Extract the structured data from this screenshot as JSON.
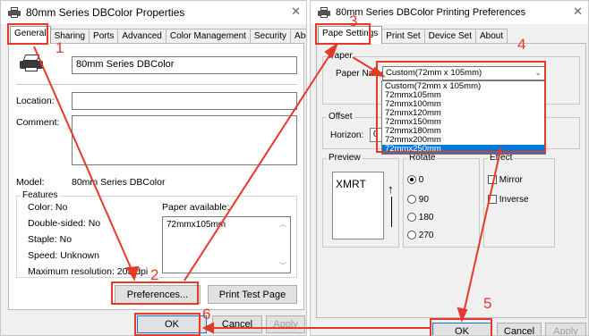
{
  "properties_window": {
    "title": "80mm Series DBColor Properties",
    "close_glyph": "✕",
    "tabs": [
      {
        "label": "General"
      },
      {
        "label": "Sharing"
      },
      {
        "label": "Ports"
      },
      {
        "label": "Advanced"
      },
      {
        "label": "Color Management"
      },
      {
        "label": "Security"
      },
      {
        "label": "About"
      }
    ],
    "printer_name_value": "80mm Series DBColor",
    "location_label": "Location:",
    "location_value": "",
    "comment_label": "Comment:",
    "comment_value": "",
    "model_label": "Model:",
    "model_value": "80mm Series DBColor",
    "features_title": "Features",
    "color_line": "Color: No",
    "double_sided_line": "Double-sided: No",
    "staple_line": "Staple: No",
    "speed_line": "Speed: Unknown",
    "max_res_line": "Maximum resolution: 203 dpi",
    "paper_available_label": "Paper available:",
    "paper_available_items": [
      "72mmx105mm"
    ],
    "preferences_button": "Preferences...",
    "print_test_page_button": "Print Test Page",
    "ok_button": "OK",
    "cancel_button": "Cancel",
    "apply_button": "Apply"
  },
  "preferences_window": {
    "title": "80mm Series DBColor Printing Preferences",
    "close_glyph": "✕",
    "tabs": [
      {
        "label": "Pape Settings"
      },
      {
        "label": "Print Set"
      },
      {
        "label": "Device Set"
      },
      {
        "label": "About"
      }
    ],
    "paper_group_title": "Paper",
    "paper_name_label": "Paper Name:",
    "paper_name_selected": "Custom(72mm x 105mm)",
    "paper_options": [
      "Custom(72mm x 105mm)",
      "72mmx105mm",
      "72mmx100mm",
      "72mmx120mm",
      "72mmx150mm",
      "72mmx180mm",
      "72mmx200mm",
      "72mmx250mm"
    ],
    "paper_selected_index": 7,
    "offset_group_title": "Offset",
    "horizon_label": "Horizon:",
    "horizon_value": "0",
    "preview_group_title": "Preview",
    "preview_text": "XMRT",
    "rotate_group_title": "Rotate",
    "rotate_options": [
      "0",
      "90",
      "180",
      "270"
    ],
    "rotate_selected_index": 0,
    "effect_group_title": "Effect",
    "effect_options": [
      "Mirror",
      "Inverse"
    ],
    "ok_button": "OK",
    "cancel_button": "Cancel",
    "apply_button": "Apply"
  },
  "annotations": {
    "step1": "1",
    "step2": "2",
    "step3": "3",
    "step4": "4",
    "step5": "5",
    "step6": "6",
    "color": "#e5392a"
  }
}
